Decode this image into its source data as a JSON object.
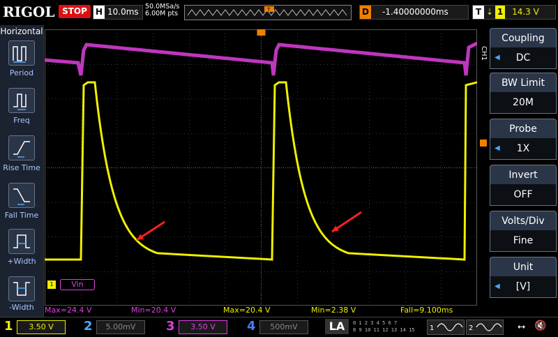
{
  "brand": "RIGOL",
  "top": {
    "run_state": "STOP",
    "timebase_key": "H",
    "timebase": "10.0ms",
    "sample_rate": "50.0MSa/s",
    "memory_depth": "6.00M pts",
    "delay_key": "D",
    "delay": "-1.40000000ms",
    "trigger_key": "T",
    "trigger_source": "1",
    "trigger_level": "14.3 V"
  },
  "left_menu": {
    "title": "Horizontal",
    "items": [
      {
        "label": "Period",
        "icon": "period-icon"
      },
      {
        "label": "Freq",
        "icon": "frequency-icon"
      },
      {
        "label": "Rise Time",
        "icon": "rise-time-icon"
      },
      {
        "label": "Fall Time",
        "icon": "fall-time-icon"
      },
      {
        "label": "+Width",
        "icon": "positive-width-icon"
      },
      {
        "label": "-Width",
        "icon": "negative-width-icon"
      }
    ]
  },
  "right_menu": {
    "channel_tag": "CH1",
    "items": [
      {
        "title": "Coupling",
        "value": "DC",
        "has_arrow": true
      },
      {
        "title": "BW Limit",
        "value": "20M",
        "has_arrow": false
      },
      {
        "title": "Probe",
        "value": "1X",
        "has_arrow": true
      },
      {
        "title": "Invert",
        "value": "OFF",
        "has_arrow": false
      },
      {
        "title": "Volts/Div",
        "value": "Fine",
        "has_arrow": false
      },
      {
        "title": "Unit",
        "value": "[V]",
        "has_arrow": true
      }
    ]
  },
  "waveform": {
    "label": "Vin",
    "ch1_color": "#f0f000",
    "ch3_color": "#e040e0",
    "marker_color": "#ff2020"
  },
  "measurements": [
    {
      "text": "Max=24.4 V",
      "color": "#e040e0"
    },
    {
      "text": "Min=20.4 V",
      "color": "#e040e0"
    },
    {
      "text": "Max=20.4 V",
      "color": "#f0f000"
    },
    {
      "text": "Min=2.38 V",
      "color": "#f0f000"
    },
    {
      "text": "Fall=9.100ms",
      "color": "#f0f000"
    }
  ],
  "channels": [
    {
      "num": "1",
      "scale": "3.50 V",
      "color": "#f0f000",
      "active": true
    },
    {
      "num": "2",
      "scale": "5.00mV",
      "color": "#4aa8ff",
      "active": false
    },
    {
      "num": "3",
      "scale": "3.50 V",
      "color": "#e040e0",
      "active": true
    },
    {
      "num": "4",
      "scale": "500mV",
      "color": "#4a7aff",
      "active": false
    }
  ],
  "la_label": "LA",
  "digital_bits": [
    "0 1 2 3  4 5 6 7",
    "8 9 10 11  12 13 14 15"
  ],
  "generators": [
    {
      "num": "1"
    },
    {
      "num": "2"
    }
  ]
}
